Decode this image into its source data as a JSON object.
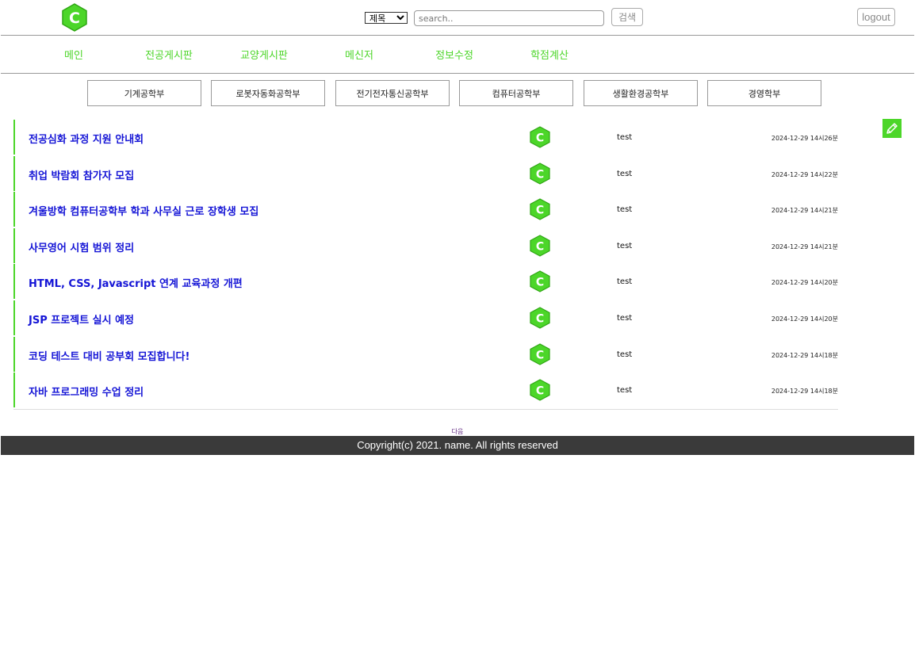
{
  "header": {
    "logo_letter": "C",
    "search_select": {
      "selected": "제목",
      "options": [
        "제목"
      ]
    },
    "search_input": {
      "value": "",
      "placeholder": "search.."
    },
    "search_button": "검색",
    "logout_button": "logout"
  },
  "nav": {
    "items": [
      "메인",
      "전공게시판",
      "교양게시판",
      "메신저",
      "정보수정",
      "학점계산"
    ]
  },
  "departments": [
    "기계공학부",
    "로봇자동화공학부",
    "전기전자통신공학부",
    "컴퓨터공학부",
    "생활환경공학부",
    "경영학부"
  ],
  "posts": [
    {
      "title": "전공심화 과정 지원 안내회",
      "author": "test",
      "date": "2024-12-29 14시26분"
    },
    {
      "title": "취업 박람회 참가자 모집",
      "author": "test",
      "date": "2024-12-29 14시22분"
    },
    {
      "title": "겨울방학 컴퓨터공학부 학과 사무실 근로 장학생 모집",
      "author": "test",
      "date": "2024-12-29 14시21분"
    },
    {
      "title": "사무영어 시험 범위 정리",
      "author": "test",
      "date": "2024-12-29 14시21분"
    },
    {
      "title": "HTML, CSS, Javascript 연계 교육과정 개편",
      "author": "test",
      "date": "2024-12-29 14시20분"
    },
    {
      "title": "JSP 프로젝트 실시 예정",
      "author": "test",
      "date": "2024-12-29 14시20분"
    },
    {
      "title": "코딩 테스트 대비 공부회 모집합니다!",
      "author": "test",
      "date": "2024-12-29 14시18분"
    },
    {
      "title": "자바 프로그래밍 수업 정리",
      "author": "test",
      "date": "2024-12-29 14시18분"
    }
  ],
  "pagination": {
    "next_label": "다음"
  },
  "footer": {
    "copyright": "Copyright(c) 2021. name. All rights reserved"
  },
  "colors": {
    "accent_green": "#4cd629",
    "title_blue": "#1515d6",
    "footer_bg": "#3a3a3a"
  }
}
